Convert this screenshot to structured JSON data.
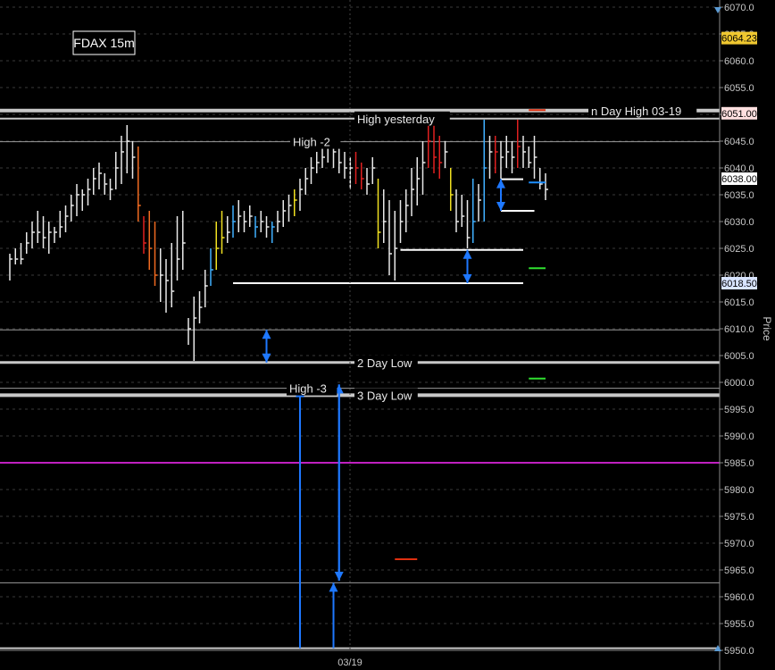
{
  "title": "FDAX 15m",
  "y_axis_label": "Price",
  "x_tick_label": "03/19",
  "chart_data": {
    "type": "ohlc",
    "ylim": [
      5950,
      6070
    ],
    "y_ticks": [
      5950,
      5955,
      5960,
      5965,
      5970,
      5975,
      5980,
      5985,
      5990,
      5995,
      6000,
      6005,
      6010,
      6015,
      6020,
      6025,
      6030,
      6035,
      6040,
      6045,
      6050,
      6055,
      6060,
      6065,
      6070
    ],
    "price_tags": [
      {
        "text": "6064.23",
        "value": 6064.23,
        "bg": "#f0c830",
        "fg": "#000000"
      },
      {
        "text": "6051.00",
        "value": 6050.2,
        "bg": "#ffe0e0",
        "fg": "#000000"
      },
      {
        "text": "6038.00",
        "value": 6038.0,
        "bg": "#ffffff",
        "fg": "#000000"
      },
      {
        "text": "6018.50",
        "value": 6018.5,
        "bg": "#d8e4ff",
        "fg": "#000000"
      }
    ],
    "levels": [
      {
        "label": "n Day High 03-19",
        "value": 6050.7,
        "color": "#c8c8c8",
        "width": 4
      },
      {
        "label": "High yesterday",
        "value": 6049.2,
        "color": "#c8c8c8",
        "width": 2
      },
      {
        "label": "High -2",
        "value": 6044.9,
        "color": "#9a9a9a",
        "width": 1
      },
      {
        "label": "2 Day Low",
        "value": 6003.7,
        "color": "#c8c8c8",
        "width": 3
      },
      {
        "label": "High -3",
        "value": 5998.9,
        "color": "#9a9a9a",
        "width": 1
      },
      {
        "label": "3 Day Low",
        "value": 5997.6,
        "color": "#c8c8c8",
        "width": 4
      },
      {
        "label": "",
        "value": 6009.8,
        "color": "#9a9a9a",
        "width": 1
      },
      {
        "label": "",
        "value": 5962.6,
        "color": "#9a9a9a",
        "width": 1
      },
      {
        "label": "",
        "value": 5950.4,
        "color": "#c8c8c8",
        "width": 2
      }
    ],
    "magenta_level": 5985.0,
    "bars": [
      [
        6024,
        6019,
        6023,
        "w"
      ],
      [
        6025,
        6022,
        6023,
        "w"
      ],
      [
        6026,
        6022,
        6023,
        "w"
      ],
      [
        6028,
        6024,
        6026,
        "w"
      ],
      [
        6030,
        6025,
        6028,
        "w"
      ],
      [
        6032,
        6026,
        6028,
        "w"
      ],
      [
        6031,
        6025,
        6027,
        "w"
      ],
      [
        6030,
        6024,
        6028,
        "w"
      ],
      [
        6029,
        6026,
        6028,
        "w"
      ],
      [
        6032,
        6027,
        6029,
        "w"
      ],
      [
        6033,
        6028,
        6031,
        "w"
      ],
      [
        6035,
        6030,
        6033,
        "w"
      ],
      [
        6037,
        6031,
        6035,
        "w"
      ],
      [
        6036,
        6032,
        6035,
        "w"
      ],
      [
        6038,
        6033,
        6036,
        "w"
      ],
      [
        6040,
        6035,
        6038,
        "w"
      ],
      [
        6041,
        6036,
        6039,
        "w"
      ],
      [
        6039,
        6035,
        6037,
        "w"
      ],
      [
        6038,
        6034,
        6036,
        "w"
      ],
      [
        6043,
        6036,
        6040,
        "w"
      ],
      [
        6046,
        6037,
        6043,
        "w"
      ],
      [
        6048,
        6039,
        6045,
        "w"
      ],
      [
        6045,
        6038,
        6042,
        "w"
      ],
      [
        6044,
        6030,
        6033,
        "o"
      ],
      [
        6031,
        6024,
        6026,
        "r"
      ],
      [
        6032,
        6021,
        6025,
        "o"
      ],
      [
        6030,
        6018,
        6020,
        "o"
      ],
      [
        6025,
        6015,
        6020,
        "w"
      ],
      [
        6023,
        6013,
        6019,
        "w"
      ],
      [
        6026,
        6014,
        6017,
        "w"
      ],
      [
        6031,
        6019,
        6023,
        "w"
      ],
      [
        6032,
        6021,
        6026,
        "w"
      ],
      [
        6012,
        6007,
        6010,
        "w"
      ],
      [
        6016,
        6004,
        6012,
        "w"
      ],
      [
        6017,
        6011,
        6014,
        "w"
      ],
      [
        6021,
        6014,
        6018,
        "w"
      ],
      [
        6025,
        6018,
        6021,
        "c"
      ],
      [
        6030,
        6021,
        6025,
        "y"
      ],
      [
        6032,
        6024,
        6027,
        "y"
      ],
      [
        6031,
        6026,
        6028,
        "w"
      ],
      [
        6033,
        6027,
        6030,
        "c"
      ],
      [
        6034,
        6028,
        6031,
        "w"
      ],
      [
        6032,
        6028,
        6030,
        "w"
      ],
      [
        6033,
        6029,
        6031,
        "w"
      ],
      [
        6031,
        6027,
        6029,
        "c"
      ],
      [
        6032,
        6028,
        6030,
        "w"
      ],
      [
        6031,
        6027,
        6029,
        "w"
      ],
      [
        6030,
        6026,
        6029,
        "c"
      ],
      [
        6032,
        6028,
        6030,
        "w"
      ],
      [
        6034,
        6029,
        6032,
        "w"
      ],
      [
        6035,
        6030,
        6033,
        "w"
      ],
      [
        6036,
        6031,
        6034,
        "y"
      ],
      [
        6038,
        6032,
        6036,
        "w"
      ],
      [
        6040,
        6035,
        6038,
        "w"
      ],
      [
        6042,
        6037,
        6040,
        "w"
      ],
      [
        6043,
        6039,
        6041,
        "w"
      ],
      [
        6044,
        6040,
        6042,
        "w"
      ],
      [
        6046,
        6041,
        6044,
        "w"
      ],
      [
        6045,
        6040,
        6043,
        "w"
      ],
      [
        6044,
        6039,
        6041,
        "w"
      ],
      [
        6043,
        6038,
        6040,
        "w"
      ],
      [
        6042,
        6036,
        6040,
        "w"
      ],
      [
        6043,
        6037,
        6040,
        "r"
      ],
      [
        6041,
        6036,
        6038,
        "r"
      ],
      [
        6040,
        6035,
        6037,
        "w"
      ],
      [
        6042,
        6037,
        6040,
        "w"
      ],
      [
        6038,
        6025,
        6028,
        "y"
      ],
      [
        6036,
        6026,
        6030,
        "w"
      ],
      [
        6034,
        6020,
        6024,
        "w"
      ],
      [
        6032,
        6019,
        6025,
        "w"
      ],
      [
        6034,
        6026,
        6030,
        "w"
      ],
      [
        6036,
        6028,
        6033,
        "w"
      ],
      [
        6040,
        6031,
        6036,
        "w"
      ],
      [
        6042,
        6033,
        6038,
        "w"
      ],
      [
        6045,
        6035,
        6041,
        "w"
      ],
      [
        6049,
        6040,
        6045,
        "r"
      ],
      [
        6048,
        6039,
        6042,
        "r"
      ],
      [
        6046,
        6038,
        6041,
        "r"
      ],
      [
        6045,
        6040,
        6043,
        "w"
      ],
      [
        6040,
        6032,
        6035,
        "y"
      ],
      [
        6036,
        6028,
        6030,
        "w"
      ],
      [
        6035,
        6029,
        6031,
        "w"
      ],
      [
        6034,
        6025,
        6027,
        "w"
      ],
      [
        6038,
        6026,
        6030,
        "c"
      ],
      [
        6037,
        6030,
        6034,
        "w"
      ],
      [
        6049,
        6030,
        6040,
        "c"
      ],
      [
        6046,
        6038,
        6043,
        "w"
      ],
      [
        6046,
        6039,
        6043,
        "r"
      ],
      [
        6045,
        6038,
        6042,
        "w"
      ],
      [
        6046,
        6040,
        6043,
        "w"
      ],
      [
        6045,
        6039,
        6042,
        "w"
      ],
      [
        6049,
        6040,
        6044,
        "r"
      ],
      [
        6046,
        6040,
        6043,
        "w"
      ],
      [
        6044,
        6040,
        6041,
        "w"
      ],
      [
        6046,
        6038,
        6042,
        "w"
      ],
      [
        6040,
        6036,
        6037,
        "w"
      ],
      [
        6039,
        6034,
        6036,
        "w"
      ]
    ],
    "color_map": {
      "w": "#e8e8e8",
      "r": "#e02020",
      "o": "#f06a20",
      "y": "#f0e020",
      "c": "#40b0ff"
    },
    "boxes": [
      {
        "x0": 0.0,
        "x1": 0.0,
        "top": 6025.0,
        "bottom": 6019.0
      }
    ],
    "short_lines": [
      {
        "i0": 70,
        "i1": 92,
        "value": 6024.7,
        "color": "#ffffff"
      },
      {
        "i0": 40,
        "i1": 92,
        "value": 6018.5,
        "color": "#ffffff"
      },
      {
        "i0": 88,
        "i1": 94,
        "value": 6032.0,
        "color": "#ffffff"
      },
      {
        "i0": 88,
        "i1": 92,
        "value": 6037.9,
        "color": "#ffffff"
      },
      {
        "i0": 93,
        "i1": 96,
        "value": 6037.3,
        "color": "#1e90ff"
      },
      {
        "i0": 93,
        "i1": 96,
        "value": 6050.8,
        "color": "#e03010"
      },
      {
        "i0": 93,
        "i1": 96,
        "value": 6021.3,
        "color": "#30e030"
      },
      {
        "i0": 93,
        "i1": 96,
        "value": 6000.7,
        "color": "#30e030"
      },
      {
        "i0": 69,
        "i1": 73,
        "value": 5967.0,
        "color": "#e03010"
      }
    ],
    "arrows": [
      {
        "i": 46,
        "from": 6009.8,
        "to": 6003.7
      },
      {
        "i": 46,
        "from": 6003.7,
        "to": 6009.8
      },
      {
        "i": 82,
        "from": 6024.7,
        "to": 6018.5
      },
      {
        "i": 82,
        "from": 6018.5,
        "to": 6024.7
      },
      {
        "i": 88,
        "from": 6037.9,
        "to": 6032.0
      },
      {
        "i": 88,
        "from": 6032.0,
        "to": 6037.9
      },
      {
        "i": 59,
        "from": 5963.0,
        "to": 5999.6
      },
      {
        "i": 59,
        "from": 5999.6,
        "to": 5963.0
      },
      {
        "i": 52,
        "from": 5950.4,
        "to": 5998.9
      },
      {
        "i": 58,
        "from": 5950.4,
        "to": 5962.6
      }
    ]
  }
}
